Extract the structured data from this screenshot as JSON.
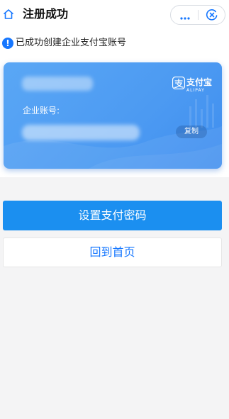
{
  "header": {
    "title": "注册成功"
  },
  "notice": {
    "text": "已成功创建企业支付宝账号"
  },
  "card": {
    "brand_name": "支付宝",
    "brand_sub": "ALIPAY",
    "account_label": "企业账号:",
    "copy_label": "复制"
  },
  "actions": {
    "primary_label": "设置支付密码",
    "secondary_label": "回到首页"
  },
  "colors": {
    "accent": "#1b8ff0",
    "link": "#1677ff",
    "card_top": "#5aa7f5",
    "card_bottom": "#3f8eef",
    "page_bg": "#f4f4f5"
  },
  "icons": [
    "home-icon",
    "more-icon",
    "mini-close-icon",
    "info-icon",
    "alipay-logo-icon"
  ]
}
